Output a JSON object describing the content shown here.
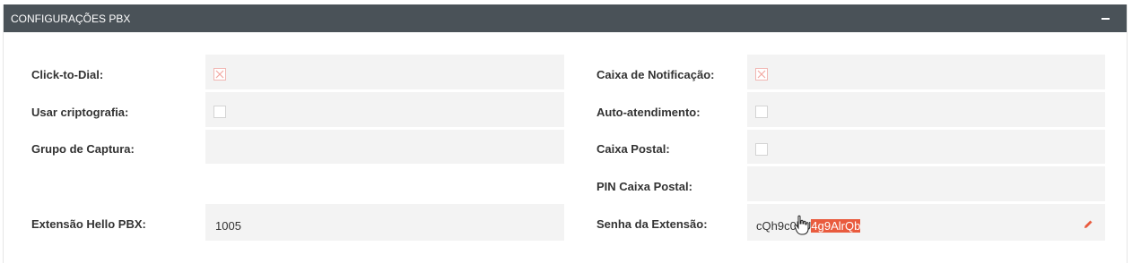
{
  "panel": {
    "title": "CONFIGURAÇÕES PBX",
    "collapse_icon": "minus-icon"
  },
  "left": {
    "click_to_dial": {
      "label": "Click-to-Dial:",
      "checked": true
    },
    "usar_criptografia": {
      "label": "Usar criptografia:",
      "checked": false
    },
    "grupo_captura": {
      "label": "Grupo de Captura:",
      "value": ""
    },
    "extensao": {
      "label": "Extensão Hello PBX:",
      "value": "1005"
    }
  },
  "right": {
    "caixa_notificacao": {
      "label": "Caixa de Notificação:",
      "checked": true
    },
    "auto_atendimento": {
      "label": "Auto-atendimento:",
      "checked": false
    },
    "caixa_postal": {
      "label": "Caixa Postal:",
      "checked": false
    },
    "pin_caixa_postal": {
      "label": "PIN Caixa Postal:",
      "value": ""
    },
    "senha_extensao": {
      "label": "Senha da Extensão:",
      "value_plain": "cQh9c0hU",
      "value_selected": "4g9AlrQb",
      "edit_icon": "pencil-icon"
    }
  },
  "colors": {
    "header_bg": "#4a5258",
    "field_bg": "#f3f3f3",
    "selection": "#e95b3e",
    "edit_icon": "#e95b3e",
    "checked_mark": "#f1b7b3"
  }
}
